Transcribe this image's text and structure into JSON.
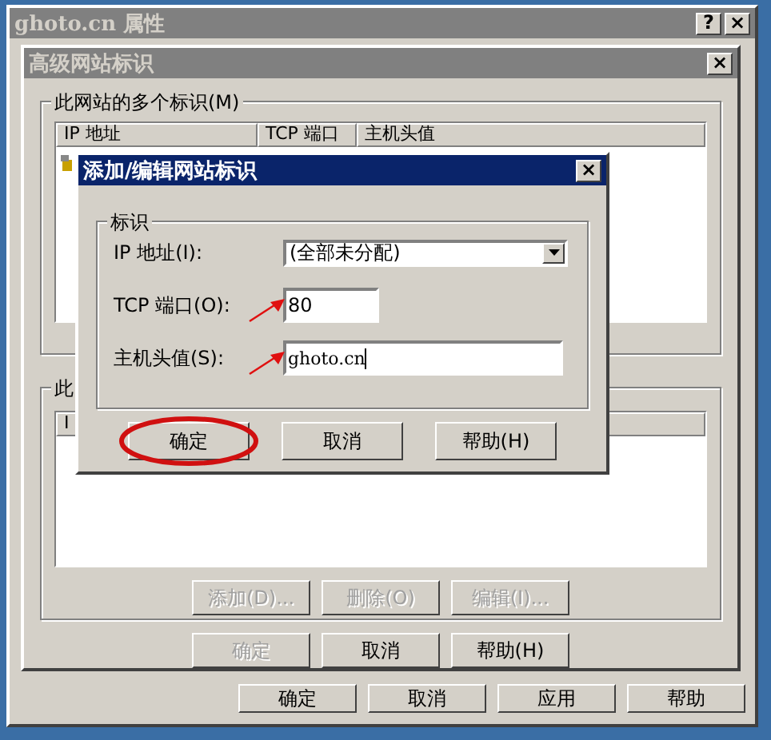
{
  "outer_window": {
    "title": "ghoto.cn 属性",
    "help_glyph": "?",
    "close_glyph": "×",
    "buttons": [
      {
        "label": "确定",
        "disabled": false
      },
      {
        "label": "取消",
        "disabled": false
      },
      {
        "label": "应用",
        "disabled": false
      },
      {
        "label": "帮助",
        "disabled": false
      }
    ]
  },
  "advanced_dialog": {
    "title": "高级网站标识",
    "close_glyph": "×",
    "identities_group": {
      "title": "此网站的多个标识(M)",
      "columns": [
        "IP 地址",
        "TCP 端口",
        "主机头值"
      ]
    },
    "second_group": {
      "title": "此",
      "column_1": "I",
      "buttons": [
        {
          "label": "添加(D)...",
          "disabled": true
        },
        {
          "label": "删除(O)",
          "disabled": true
        },
        {
          "label": "编辑(I)...",
          "disabled": true
        }
      ]
    },
    "buttons": [
      {
        "label": "确定",
        "disabled": true
      },
      {
        "label": "取消",
        "disabled": false
      },
      {
        "label": "帮助(H)",
        "disabled": false
      }
    ]
  },
  "edit_dialog": {
    "title": "添加/编辑网站标识",
    "close_glyph": "×",
    "group_title": "标识",
    "fields": [
      {
        "kind": "dropdown",
        "label": "IP 地址(I):",
        "value": "(全部未分配)"
      },
      {
        "kind": "text",
        "label": "TCP 端口(O):",
        "value": "80",
        "arrow": true
      },
      {
        "kind": "text",
        "label": "主机头值(S):",
        "value": "ghoto.cn",
        "arrow": true
      }
    ],
    "buttons": [
      {
        "label": "确定",
        "circled": true
      },
      {
        "label": "取消",
        "circled": false
      },
      {
        "label": "帮助(H)",
        "circled": false
      }
    ]
  }
}
